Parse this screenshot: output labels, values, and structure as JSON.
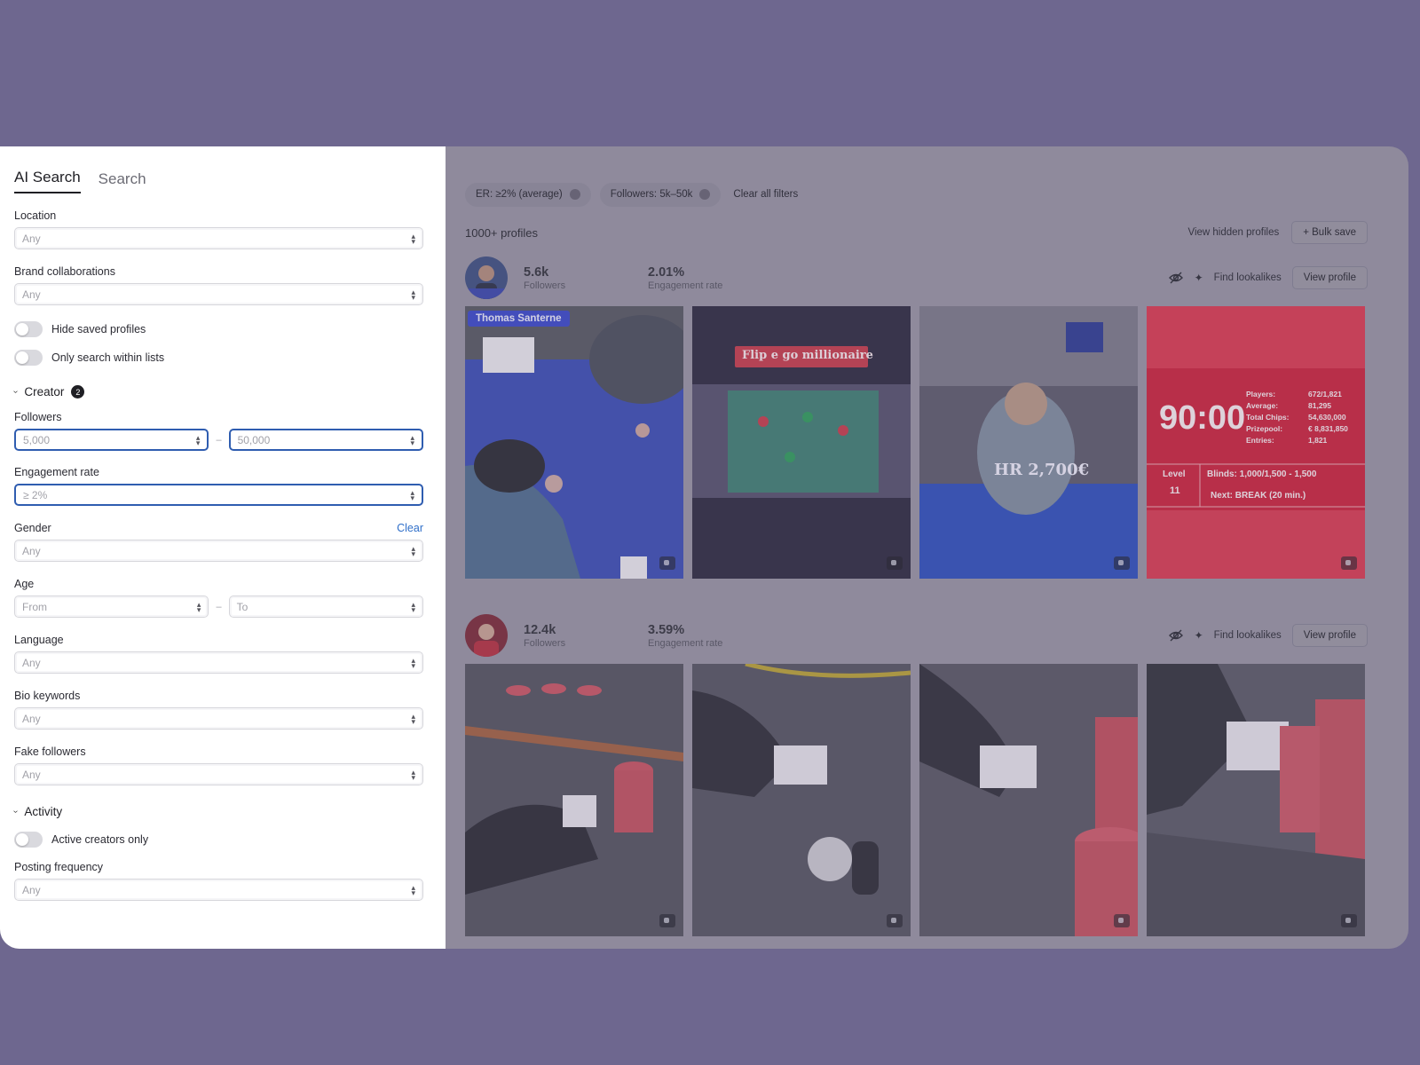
{
  "sidebar": {
    "tabs": [
      {
        "label": "AI Search",
        "active": true
      },
      {
        "label": "Search",
        "active": false
      }
    ],
    "location": {
      "label": "Location",
      "value": "Any"
    },
    "brand_collaborations": {
      "label": "Brand collaborations",
      "value": "Any"
    },
    "toggles": [
      {
        "label": "Hide saved profiles",
        "on": false
      },
      {
        "label": "Only search within lists",
        "on": false
      }
    ],
    "creator_section": {
      "label": "Creator",
      "badge": "2"
    },
    "followers": {
      "label": "Followers",
      "from": "5,000",
      "to": "50,000",
      "dash": "–"
    },
    "engagement_rate": {
      "label": "Engagement rate",
      "value": "≥ 2%"
    },
    "gender": {
      "label": "Gender",
      "clear": "Clear",
      "value": "Any"
    },
    "age": {
      "label": "Age",
      "from": "From",
      "to": "To",
      "dash": "–"
    },
    "language": {
      "label": "Language",
      "value": "Any"
    },
    "bio_keywords": {
      "label": "Bio keywords",
      "value": "Any"
    },
    "fake_followers": {
      "label": "Fake followers",
      "value": "Any"
    },
    "activity_section": {
      "label": "Activity"
    },
    "active_creators": {
      "label": "Active creators only",
      "on": false
    },
    "posting_frequency": {
      "label": "Posting frequency",
      "value": "Any"
    }
  },
  "main": {
    "chips": [
      {
        "label": "ER: ≥2% (average)"
      },
      {
        "label": "Followers: 5k–50k"
      }
    ],
    "clear_all": "Clear all filters",
    "count": "1000+ profiles",
    "view_hidden": "View hidden profiles",
    "bulk_save": "+ Bulk save",
    "profiles": [
      {
        "followers": "5.6k",
        "followers_label": "Followers",
        "er": "2.01%",
        "er_label": "Engagement rate",
        "find_lookalikes": "Find lookalikes",
        "view_profile": "View profile",
        "tile1_tag": "Thomas Santerne",
        "tile2_text": "Flip e go millionaire",
        "tile3_text": "HR 2,700€",
        "tile4_clock": "90:00",
        "tile4_stats": [
          "Players:",
          "672/1,821",
          "Average:",
          "81,295",
          "Total Chips:",
          "54,630,000",
          "Prizepool:",
          "€ 8,831,850",
          "Entries:",
          "1,821"
        ],
        "tile4_level": "Level",
        "tile4_level_num": "11",
        "tile4_blinds": "Blinds: 1,000/1,500 - 1,500",
        "tile4_next": "Next: BREAK (20 min.)"
      },
      {
        "followers": "12.4k",
        "followers_label": "Followers",
        "er": "3.59%",
        "er_label": "Engagement rate",
        "find_lookalikes": "Find lookalikes",
        "view_profile": "View profile"
      }
    ]
  },
  "colors": {
    "backdrop": "#6e678f",
    "focus_border": "#2f5db0",
    "name_tag": "#3a47c5",
    "card_red": "#c8233a"
  }
}
